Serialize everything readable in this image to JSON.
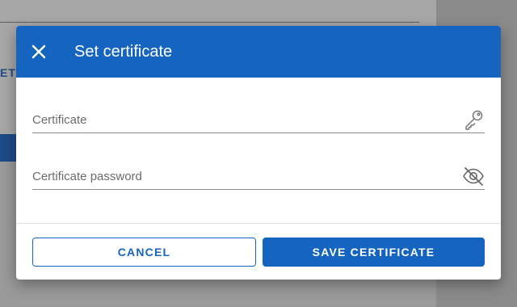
{
  "background": {
    "fragment_text": "ET"
  },
  "dialog": {
    "title": "Set certificate",
    "close_icon": "close-icon",
    "fields": [
      {
        "placeholder": "Certificate",
        "value": "",
        "icon": "key-icon"
      },
      {
        "placeholder": "Certificate password",
        "value": "",
        "icon": "eye-off-icon"
      }
    ],
    "buttons": {
      "cancel_label": "CANCEL",
      "save_label": "SAVE CERTIFICATE"
    }
  },
  "colors": {
    "primary": "#1565c0",
    "overlay": "#8b8b8b"
  }
}
